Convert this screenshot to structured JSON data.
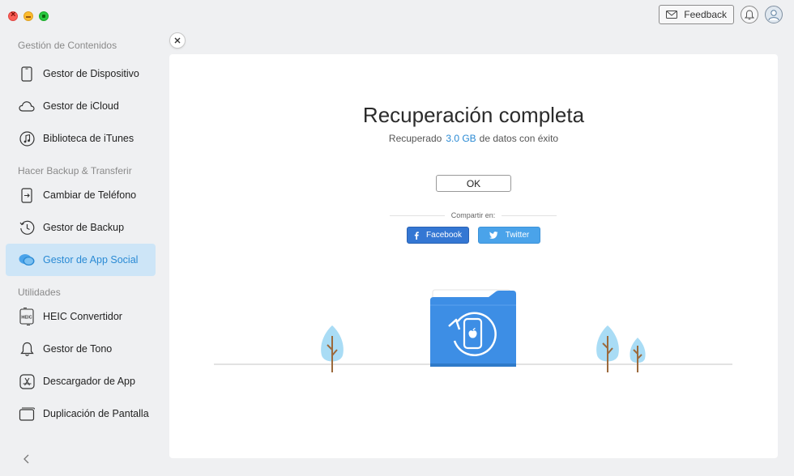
{
  "window": {
    "feedback_label": "Feedback"
  },
  "sidebar": {
    "sections": [
      {
        "title": "Gestión de Contenidos",
        "items": [
          {
            "label": "Gestor de Dispositivo",
            "icon": "phone-icon"
          },
          {
            "label": "Gestor de iCloud",
            "icon": "cloud-icon"
          },
          {
            "label": "Biblioteca de iTunes",
            "icon": "music-icon"
          }
        ]
      },
      {
        "title": "Hacer Backup & Transferir",
        "items": [
          {
            "label": "Cambiar de Teléfono",
            "icon": "phone-switch-icon"
          },
          {
            "label": "Gestor de Backup",
            "icon": "history-icon"
          },
          {
            "label": "Gestor de App Social",
            "icon": "chat-bubbles-icon",
            "active": true
          }
        ]
      },
      {
        "title": "Utilidades",
        "items": [
          {
            "label": "HEIC Convertidor",
            "icon": "heic-icon"
          },
          {
            "label": "Gestor de Tono",
            "icon": "bell-icon"
          },
          {
            "label": "Descargador de App",
            "icon": "app-store-icon"
          },
          {
            "label": "Duplicación de Pantalla",
            "icon": "screen-mirror-icon"
          }
        ]
      }
    ]
  },
  "main": {
    "title": "Recuperación completa",
    "subtitle_prefix": "Recuperado",
    "subtitle_amount": "3.0 GB",
    "subtitle_suffix": "de datos con éxito",
    "ok_label": "OK",
    "share_label": "Compartir en:",
    "facebook_label": "Facebook",
    "twitter_label": "Twitter"
  },
  "colors": {
    "accent": "#2a8ad4",
    "active_bg": "#cde5f7",
    "facebook": "#3477d3",
    "twitter": "#4aa3ea",
    "folder": "#3d8ee5"
  }
}
